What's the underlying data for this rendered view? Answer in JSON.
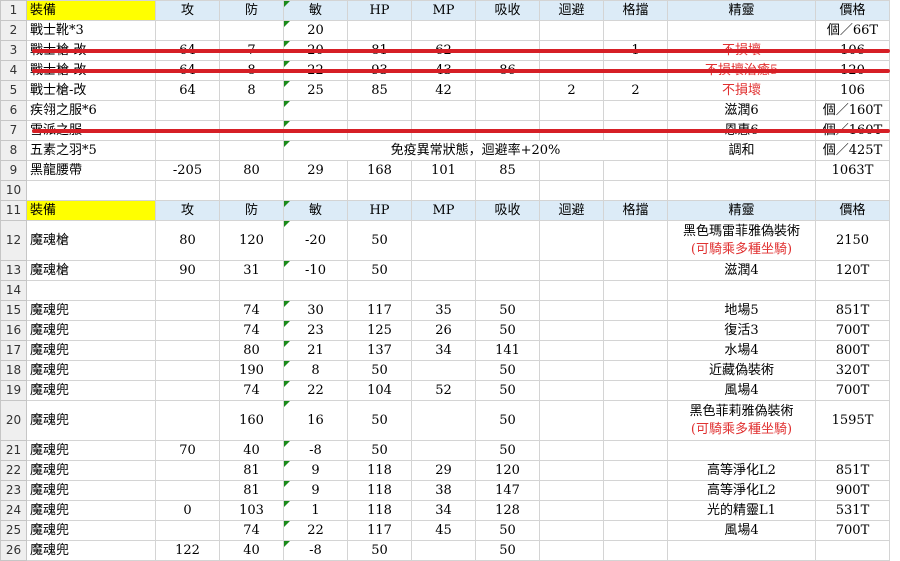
{
  "columns": [
    "裝備",
    "攻",
    "防",
    "敏",
    "HP",
    "MP",
    "吸收",
    "迴避",
    "格擋",
    "精靈",
    "價格"
  ],
  "rows": [
    {
      "n": "1",
      "cells": [
        "裝備",
        "攻",
        "防",
        "敏",
        "HP",
        "MP",
        "吸收",
        "迴避",
        "格擋",
        "精靈",
        "價格"
      ],
      "header": true
    },
    {
      "n": "2",
      "cells": [
        "戰士靴*3",
        "",
        "",
        "20",
        "",
        "",
        "",
        "",
        "",
        "",
        "個／66T"
      ]
    },
    {
      "n": "3",
      "cells": [
        "戰士槍-改",
        "64",
        "7",
        "20",
        "81",
        "62",
        "",
        "",
        "1",
        "不損壞",
        "106"
      ],
      "struck": true
    },
    {
      "n": "4",
      "cells": [
        "戰士槍-改",
        "64",
        "8",
        "22",
        "93",
        "43",
        "86",
        "",
        "",
        "不損壞治癒5",
        "120"
      ],
      "struck": true
    },
    {
      "n": "5",
      "cells": [
        "戰士槍-改",
        "64",
        "8",
        "25",
        "85",
        "42",
        "",
        "2",
        "2",
        "不損壞",
        "106"
      ]
    },
    {
      "n": "6",
      "cells": [
        "疾翎之服*6",
        "",
        "",
        "",
        "",
        "",
        "",
        "",
        "",
        "滋潤6",
        "個／160T"
      ]
    },
    {
      "n": "7",
      "cells": [
        "雪派之服",
        "",
        "",
        "",
        "",
        "",
        "",
        "",
        "",
        "恩惠6",
        "個／160T"
      ],
      "struck": true
    },
    {
      "n": "8",
      "cells": [
        "五素之羽*5",
        "",
        "",
        "免疫異常狀態，迴避率+20%",
        "",
        "",
        "",
        "",
        "",
        "調和",
        "個／425T"
      ]
    },
    {
      "n": "9",
      "cells": [
        "黑龍腰帶",
        "-205",
        "80",
        "29",
        "168",
        "101",
        "85",
        "",
        "",
        "",
        "1063T"
      ]
    },
    {
      "n": "10",
      "cells": [
        "",
        "",
        "",
        "",
        "",
        "",
        "",
        "",
        "",
        "",
        ""
      ]
    },
    {
      "n": "11",
      "cells": [
        "裝備",
        "攻",
        "防",
        "敏",
        "HP",
        "MP",
        "吸收",
        "迴避",
        "格擋",
        "精靈",
        "價格"
      ],
      "header": true
    },
    {
      "n": "12",
      "cells": [
        "魔魂槍",
        "80",
        "120",
        "-20",
        "50",
        "",
        "",
        "",
        "",
        "黑色瑪雷菲雅偽裝術",
        "2150"
      ],
      "note": "(可騎乘多種坐騎)",
      "tall": true
    },
    {
      "n": "13",
      "cells": [
        "魔魂槍",
        "90",
        "31",
        "-10",
        "50",
        "",
        "",
        "",
        "",
        "滋潤4",
        "120T"
      ]
    },
    {
      "n": "14",
      "cells": [
        "",
        "",
        "",
        "",
        "",
        "",
        "",
        "",
        "",
        "",
        ""
      ]
    },
    {
      "n": "15",
      "cells": [
        "魔魂兜",
        "",
        "74",
        "30",
        "117",
        "35",
        "50",
        "",
        "",
        "地場5",
        "851T"
      ]
    },
    {
      "n": "16",
      "cells": [
        "魔魂兜",
        "",
        "74",
        "23",
        "125",
        "26",
        "50",
        "",
        "",
        "復活3",
        "700T"
      ]
    },
    {
      "n": "17",
      "cells": [
        "魔魂兜",
        "",
        "80",
        "21",
        "137",
        "34",
        "141",
        "",
        "",
        "水場4",
        "800T"
      ]
    },
    {
      "n": "18",
      "cells": [
        "魔魂兜",
        "",
        "190",
        "8",
        "50",
        "",
        "50",
        "",
        "",
        "近藏偽裝術",
        "320T"
      ]
    },
    {
      "n": "19",
      "cells": [
        "魔魂兜",
        "",
        "74",
        "22",
        "104",
        "52",
        "50",
        "",
        "",
        "風場4",
        "700T"
      ]
    },
    {
      "n": "20",
      "cells": [
        "魔魂兜",
        "",
        "160",
        "16",
        "50",
        "",
        "50",
        "",
        "",
        "黑色菲莉雅偽裝術",
        "1595T"
      ],
      "note": "(可騎乘多種坐騎)",
      "tall": true
    },
    {
      "n": "21",
      "cells": [
        "魔魂兜",
        "70",
        "40",
        "-8",
        "50",
        "",
        "50",
        "",
        "",
        "",
        ""
      ]
    },
    {
      "n": "22",
      "cells": [
        "魔魂兜",
        "",
        "81",
        "9",
        "118",
        "29",
        "120",
        "",
        "",
        "高等淨化L2",
        "851T"
      ]
    },
    {
      "n": "23",
      "cells": [
        "魔魂兜",
        "",
        "81",
        "9",
        "118",
        "38",
        "147",
        "",
        "",
        "高等淨化L2",
        "900T"
      ]
    },
    {
      "n": "24",
      "cells": [
        "魔魂兜",
        "0",
        "103",
        "1",
        "118",
        "34",
        "128",
        "",
        "",
        "光的精靈L1",
        "531T"
      ]
    },
    {
      "n": "25",
      "cells": [
        "魔魂兜",
        "",
        "74",
        "22",
        "117",
        "45",
        "50",
        "",
        "",
        "風場4",
        "700T"
      ]
    },
    {
      "n": "26",
      "cells": [
        "魔魂兜",
        "122",
        "40",
        "-8",
        "50",
        "",
        "50",
        "",
        "",
        "",
        ""
      ]
    }
  ]
}
